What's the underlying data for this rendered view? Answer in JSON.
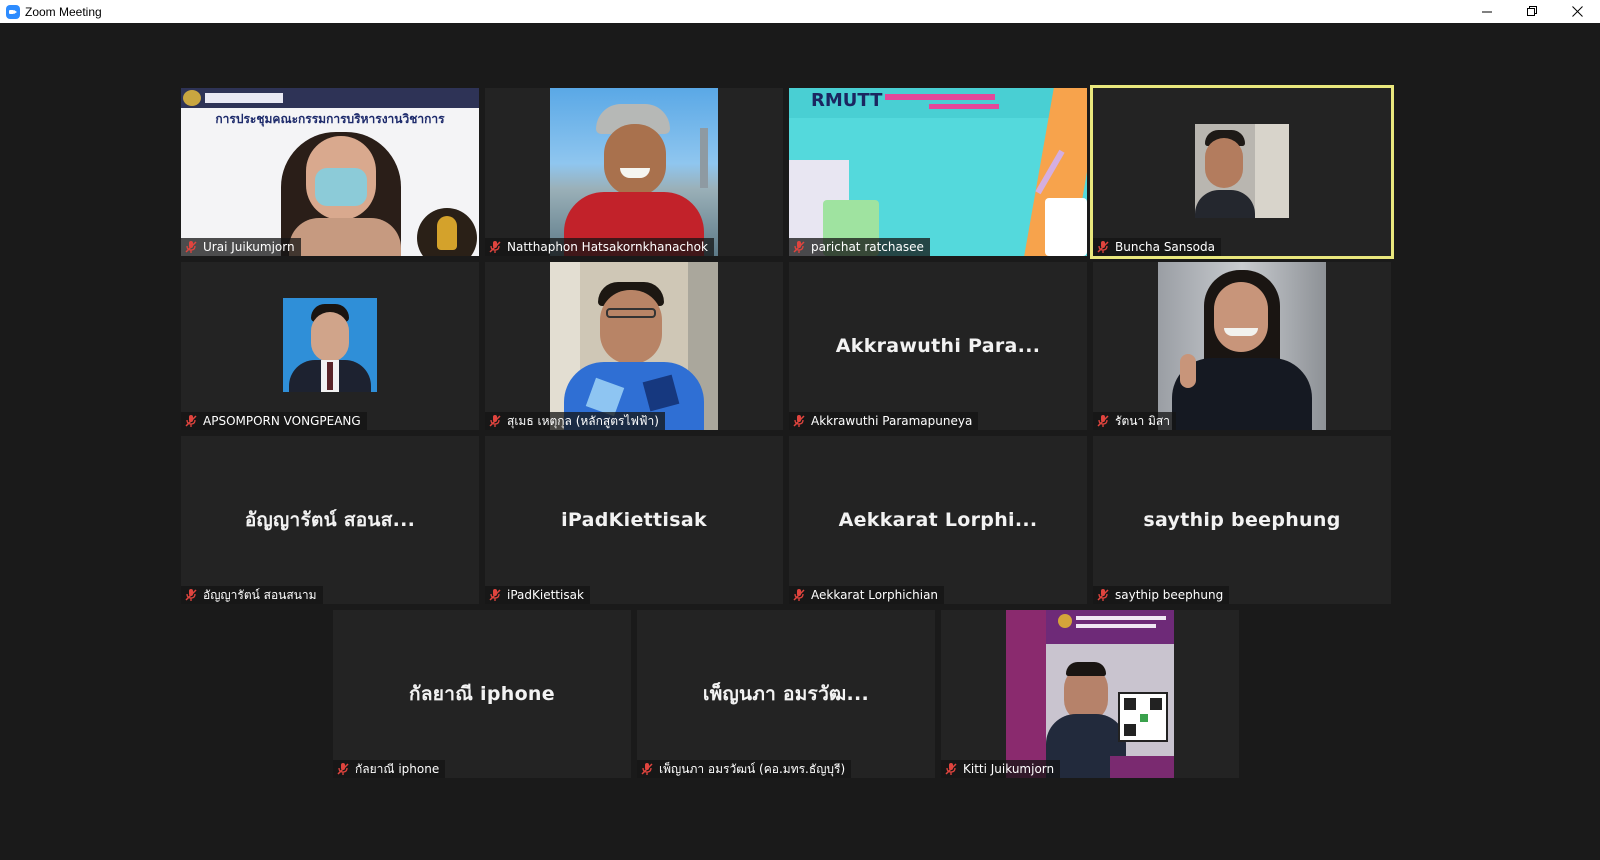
{
  "window": {
    "title": "Zoom Meeting"
  },
  "colors": {
    "active_border": "#e9e77d",
    "muted_mic": "#e0443e",
    "tile_bg": "#232323"
  },
  "participants": [
    {
      "name": "Urai Juikumjorn",
      "video": true,
      "slide_text": "การประชุมคณะกรรมการบริหารงานวิชาการ"
    },
    {
      "name": "Natthaphon Hatsakornkhanachok",
      "video": true
    },
    {
      "name": "parichat ratchasee",
      "video": true,
      "slide_text": "RMUTT"
    },
    {
      "name": "Buncha Sansoda",
      "video": true,
      "active": true
    },
    {
      "name": "APSOMPORN VONGPEANG",
      "video": true
    },
    {
      "name": "สุเมธ เหตุกุล (หลักสูตรไฟฟ้า)",
      "video": true
    },
    {
      "name": "Akkrawuthi Paramapuneya",
      "display": "Akkrawuthi  Para...",
      "video": false
    },
    {
      "name": "รัตนา มิสา",
      "video": true
    },
    {
      "name": "อัญญารัตน์ สอนสนาม",
      "display": "อัญญารัตน์  สอนส...",
      "video": false
    },
    {
      "name": "iPadKiettisak",
      "display": "iPadKiettisak",
      "video": false
    },
    {
      "name": "Aekkarat Lorphichian",
      "display": "Aekkarat  Lorphi...",
      "video": false
    },
    {
      "name": "saythip beephung",
      "display": "saythip beephung",
      "video": false
    },
    {
      "name": "กัลยาณี iphone",
      "display": "กัลยาณี iphone",
      "video": false
    },
    {
      "name": "เพ็ญนภา  อมรวัฒน์  (คอ.มทร.ธัญบุรี)",
      "display": "เพ็ญนภา  อมรวัฒ...",
      "video": false
    },
    {
      "name": "Kitti Juikumjorn",
      "video": true
    }
  ]
}
